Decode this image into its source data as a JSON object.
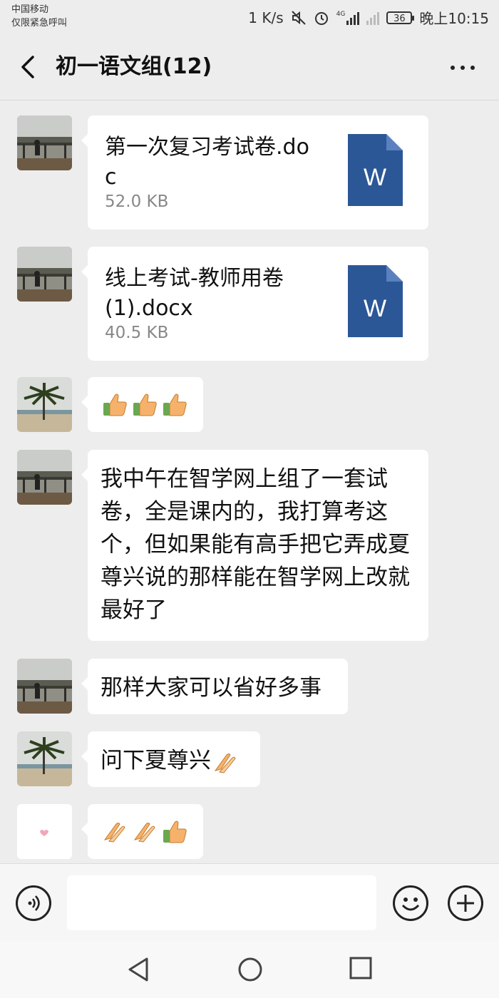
{
  "status_bar": {
    "carrier": "中国移动",
    "emergency": "仅限紧急呼叫",
    "speed": "1 K/s",
    "battery": "36",
    "time": "晚上10:15"
  },
  "header": {
    "title": "初一语文组(12)"
  },
  "messages": [
    {
      "type": "file",
      "name": "第一次复习考试卷.doc",
      "size": "52.0 KB",
      "file_icon_letter": "W"
    },
    {
      "type": "file",
      "name": "线上考试-教师用卷(1).docx",
      "size": "40.5 KB",
      "file_icon_letter": "W"
    },
    {
      "type": "emoji",
      "emojis": [
        "thumbs-up",
        "thumbs-up",
        "thumbs-up"
      ]
    },
    {
      "type": "text",
      "text": "我中午在智学网上组了一套试卷，全是课内的，我打算考这个，但如果能有高手把它弄成夏尊兴说的那样能在智学网上改就最好了"
    },
    {
      "type": "text",
      "text": "那样大家可以省好多事"
    },
    {
      "type": "text",
      "text": "问下夏尊兴",
      "trailing_emoji": "clapping-hands"
    },
    {
      "type": "emoji",
      "emojis": [
        "clapping-hands",
        "clapping-hands",
        "thumbs-up"
      ]
    }
  ],
  "input": {
    "value": "",
    "placeholder": ""
  },
  "colors": {
    "word_blue": "#2b5797",
    "bubble": "#ffffff",
    "background": "#ededed"
  }
}
